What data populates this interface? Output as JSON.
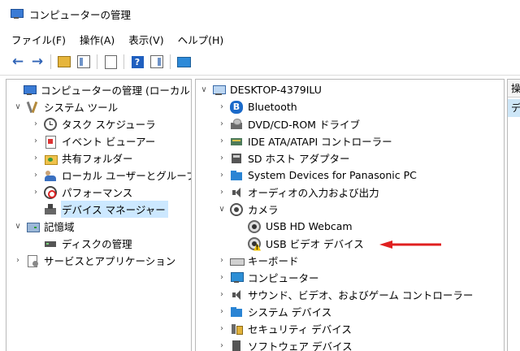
{
  "window": {
    "title": "コンピューターの管理"
  },
  "menu": [
    "ファイル(F)",
    "操作(A)",
    "表示(V)",
    "ヘルプ(H)"
  ],
  "left_tree": [
    {
      "label": "コンピューターの管理 (ローカル)",
      "icon": "computer-icon",
      "toggle": ""
    },
    {
      "label": "システム ツール",
      "icon": "tools-icon",
      "toggle": "expanded"
    },
    {
      "label": "タスク スケジューラ",
      "icon": "clock-icon",
      "toggle": "collapsed"
    },
    {
      "label": "イベント ビューアー",
      "icon": "event-viewer-icon",
      "toggle": "collapsed"
    },
    {
      "label": "共有フォルダー",
      "icon": "shared-folder-icon",
      "toggle": "collapsed"
    },
    {
      "label": "ローカル ユーザーとグループ",
      "icon": "users-icon",
      "toggle": "collapsed"
    },
    {
      "label": "パフォーマンス",
      "icon": "performance-icon",
      "toggle": "collapsed"
    },
    {
      "label": "デバイス マネージャー",
      "icon": "device-manager-icon",
      "toggle": "",
      "selected": true
    },
    {
      "label": "記憶域",
      "icon": "storage-icon",
      "toggle": "expanded"
    },
    {
      "label": "ディスクの管理",
      "icon": "disk-icon",
      "toggle": ""
    },
    {
      "label": "サービスとアプリケーション",
      "icon": "services-icon",
      "toggle": "collapsed"
    }
  ],
  "device_tree": [
    {
      "label": "DESKTOP-4379ILU",
      "icon": "pc-icon",
      "toggle": "expanded"
    },
    {
      "label": "Bluetooth",
      "icon": "bluetooth-icon",
      "toggle": "collapsed"
    },
    {
      "label": "DVD/CD-ROM ドライブ",
      "icon": "dvd-drive-icon",
      "toggle": "collapsed"
    },
    {
      "label": "IDE ATA/ATAPI コントローラー",
      "icon": "ide-controller-icon",
      "toggle": "collapsed"
    },
    {
      "label": "SD ホスト アダプター",
      "icon": "sd-host-icon",
      "toggle": "collapsed"
    },
    {
      "label": "System Devices for Panasonic PC",
      "icon": "system-folder-icon",
      "toggle": "collapsed"
    },
    {
      "label": "オーディオの入力および出力",
      "icon": "audio-icon",
      "toggle": "collapsed"
    },
    {
      "label": "カメラ",
      "icon": "camera-icon",
      "toggle": "expanded"
    },
    {
      "label": "USB HD Webcam",
      "icon": "webcam-icon",
      "toggle": ""
    },
    {
      "label": "USB ビデオ デバイス",
      "icon": "warning-camera-icon",
      "toggle": ""
    },
    {
      "label": "キーボード",
      "icon": "keyboard-icon",
      "toggle": "collapsed"
    },
    {
      "label": "コンピューター",
      "icon": "monitor-icon",
      "toggle": "collapsed"
    },
    {
      "label": "サウンド、ビデオ、およびゲーム コントローラー",
      "icon": "audio-icon",
      "toggle": "collapsed"
    },
    {
      "label": "システム デバイス",
      "icon": "system-folder-icon",
      "toggle": "collapsed"
    },
    {
      "label": "セキュリティ デバイス",
      "icon": "security-icon",
      "toggle": "collapsed"
    },
    {
      "label": "ソフトウェア デバイス",
      "icon": "software-icon",
      "toggle": "collapsed"
    }
  ],
  "actions_pane": {
    "header": "操",
    "item": "デ"
  },
  "colors": {
    "arrow": "#e02020",
    "selection": "#cce8ff"
  }
}
